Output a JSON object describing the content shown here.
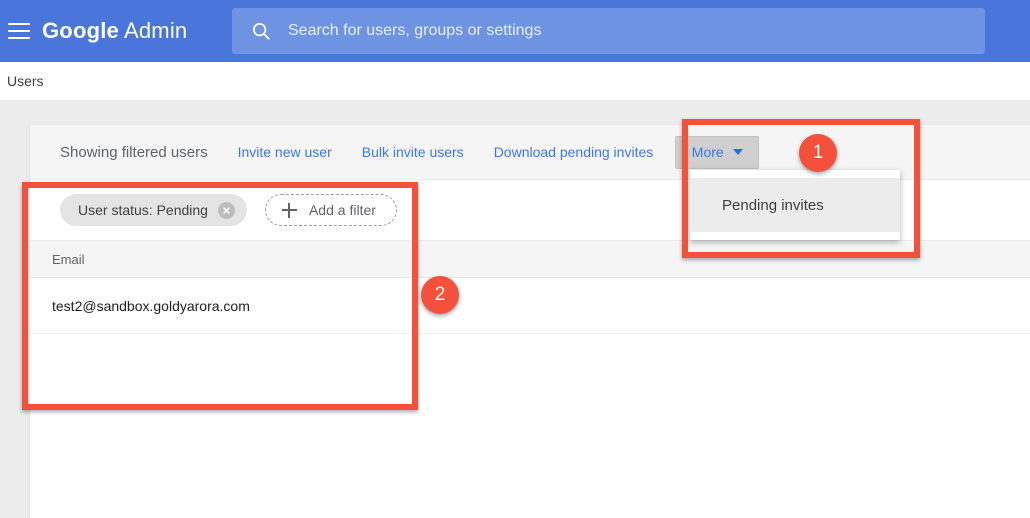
{
  "appbar": {
    "menu_icon": "hamburger-menu-icon",
    "brand_strong": "Google",
    "brand_light": "Admin",
    "search": {
      "icon": "search-icon",
      "placeholder": "Search for users, groups or settings",
      "value": ""
    }
  },
  "breadcrumb": {
    "current": "Users"
  },
  "toolbar": {
    "title": "Showing filtered users",
    "links": [
      {
        "label": "Invite new user"
      },
      {
        "label": "Bulk invite users"
      },
      {
        "label": "Download pending invites"
      }
    ],
    "more_button": {
      "label": "More",
      "caret_icon": "chevron-down-icon"
    }
  },
  "dropdown": {
    "items": [
      {
        "label": "Pending invites",
        "hovered": true
      }
    ]
  },
  "filters": {
    "chip": {
      "label": "User status: Pending",
      "remove_icon": "close-circle-icon"
    },
    "add_filter": {
      "icon": "plus-icon",
      "label": "Add a filter"
    }
  },
  "table": {
    "columns": [
      "Email"
    ],
    "rows": [
      {
        "email": "test2@sandbox.goldyarora.com"
      }
    ]
  },
  "annotations": [
    {
      "badge": "1",
      "target": "more-button-and-dropdown"
    },
    {
      "badge": "2",
      "target": "filters-and-results-table"
    }
  ],
  "colors": {
    "appbar_blue": "#4a76db",
    "search_blue": "#6e93e3",
    "link_blue": "#3b78e7",
    "annotation_red": "#f4503c",
    "page_background": "#ececec",
    "row_header_gray": "#f5f5f5"
  }
}
